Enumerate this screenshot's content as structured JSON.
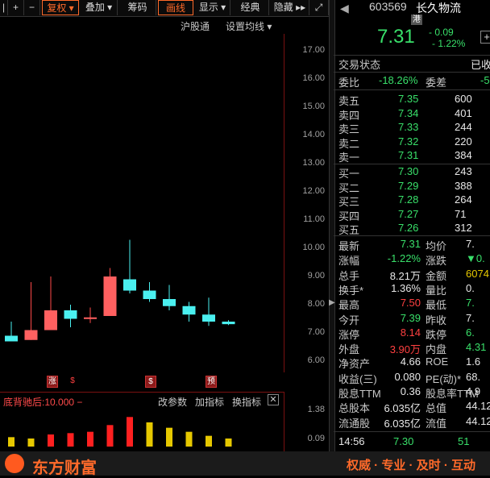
{
  "toolbar": {
    "items": [
      "|",
      "+",
      "−",
      "复权",
      "叠加",
      "筹码",
      "画线",
      "显示",
      "经典",
      "隐藏"
    ],
    "fuquan_label": "复权",
    "overlay_label": "叠加",
    "chips_label": "筹码",
    "draw_label": "画线",
    "show_label": "显示",
    "classic_label": "经典",
    "hide_label": "隐藏",
    "expand_icon": "expand-icon"
  },
  "subtoolbar": {
    "hgt_label": "沪股通",
    "ma_label": "设置均线"
  },
  "price_axis": [
    "17.00",
    "16.00",
    "15.00",
    "14.00",
    "13.00",
    "12.00",
    "11.00",
    "10.00",
    "9.00",
    "8.00",
    "7.00",
    "6.00"
  ],
  "chart_data": {
    "type": "candlestick",
    "candles": [
      {
        "open": 6.7,
        "close": 6.9,
        "high": 7.4,
        "low": 6.7,
        "color": "cyan"
      },
      {
        "open": 6.75,
        "close": 7.1,
        "high": 8.8,
        "low": 6.75,
        "color": "red"
      },
      {
        "open": 7.1,
        "close": 7.8,
        "high": 9.0,
        "low": 7.1,
        "color": "red"
      },
      {
        "open": 7.8,
        "close": 7.5,
        "high": 8.0,
        "low": 7.2,
        "color": "cyan"
      },
      {
        "open": 7.5,
        "close": 7.55,
        "high": 7.9,
        "low": 7.35,
        "color": "red"
      },
      {
        "open": 7.6,
        "close": 9.0,
        "high": 9.3,
        "low": 7.6,
        "color": "red"
      },
      {
        "open": 8.9,
        "close": 8.5,
        "high": 10.3,
        "low": 8.4,
        "color": "cyan"
      },
      {
        "open": 8.5,
        "close": 8.2,
        "high": 8.8,
        "low": 8.1,
        "color": "cyan"
      },
      {
        "open": 8.2,
        "close": 7.95,
        "high": 8.7,
        "low": 7.8,
        "color": "cyan"
      },
      {
        "open": 7.95,
        "close": 7.65,
        "high": 8.1,
        "low": 7.4,
        "color": "cyan"
      },
      {
        "open": 7.65,
        "close": 7.4,
        "high": 8.25,
        "low": 7.25,
        "color": "cyan"
      },
      {
        "open": 7.4,
        "close": 7.31,
        "high": 7.45,
        "low": 7.28,
        "color": "cyan"
      }
    ],
    "ylim": [
      5.6,
      17.6
    ]
  },
  "badges": [
    {
      "text": "涨"
    },
    {
      "text": "$"
    },
    {
      "text": "$"
    },
    {
      "text": "预"
    }
  ],
  "indicator": {
    "title": "底背驰后:10.000 −",
    "change_param": "改参数",
    "add_indicator": "加指标",
    "switch_indicator": "换指标",
    "close_icon": "close-icon",
    "axis_top": "1.38",
    "axis_bottom": "0.09",
    "vol_bars": [
      {
        "v": 0.35,
        "color": "#e6c800"
      },
      {
        "v": 0.3,
        "color": "#e6c800"
      },
      {
        "v": 0.45,
        "color": "#ff2020"
      },
      {
        "v": 0.5,
        "color": "#ff2020"
      },
      {
        "v": 0.55,
        "color": "#ff2020"
      },
      {
        "v": 0.8,
        "color": "#ff2020"
      },
      {
        "v": 1.1,
        "color": "#ff2020"
      },
      {
        "v": 0.9,
        "color": "#e6c800"
      },
      {
        "v": 0.7,
        "color": "#e6c800"
      },
      {
        "v": 0.55,
        "color": "#e6c800"
      },
      {
        "v": 0.4,
        "color": "#e6c800"
      },
      {
        "v": 0.3,
        "color": "#e6c800"
      }
    ]
  },
  "quote": {
    "code": "603569",
    "name": "长久物流",
    "hk_tag": "港",
    "last": "7.31",
    "change": "- 0.09",
    "change_pct": "- 1.22%",
    "status_label": "交易状态",
    "status_value": "已收",
    "ratio_label": "委比",
    "ratio_value": "-18.26%",
    "diff_label": "委差",
    "diff_value": "-5",
    "sells": [
      {
        "label": "卖五",
        "price": "7.35",
        "vol": "600"
      },
      {
        "label": "卖四",
        "price": "7.34",
        "vol": "401"
      },
      {
        "label": "卖三",
        "price": "7.33",
        "vol": "244"
      },
      {
        "label": "卖二",
        "price": "7.32",
        "vol": "220"
      },
      {
        "label": "卖一",
        "price": "7.31",
        "vol": "384"
      }
    ],
    "buys": [
      {
        "label": "买一",
        "price": "7.30",
        "vol": "243"
      },
      {
        "label": "买二",
        "price": "7.29",
        "vol": "388"
      },
      {
        "label": "买三",
        "price": "7.28",
        "vol": "264"
      },
      {
        "label": "买四",
        "price": "7.27",
        "vol": "71"
      },
      {
        "label": "买五",
        "price": "7.26",
        "vol": "312"
      }
    ],
    "stats": [
      {
        "l1": "最新",
        "v1": "7.31",
        "c1": "grn",
        "l2": "均价",
        "v2": "7.",
        "c2": "wht"
      },
      {
        "l1": "涨幅",
        "v1": "-1.22%",
        "c1": "grn",
        "l2": "涨跌",
        "v2": "▼0.",
        "c2": "grn"
      },
      {
        "l1": "总手",
        "v1": "8.21万",
        "c1": "wht",
        "l2": "金额",
        "v2": "6074",
        "c2": "ylw"
      },
      {
        "l1": "换手*",
        "v1": "1.36%",
        "c1": "wht",
        "l2": "量比",
        "v2": "0.",
        "c2": "wht"
      },
      {
        "l1": "最高",
        "v1": "7.50",
        "c1": "red",
        "l2": "最低",
        "v2": "7.",
        "c2": "grn"
      },
      {
        "l1": "今开",
        "v1": "7.39",
        "c1": "grn",
        "l2": "昨收",
        "v2": "7.",
        "c2": "wht"
      },
      {
        "l1": "涨停",
        "v1": "8.14",
        "c1": "red",
        "l2": "跌停",
        "v2": "6.",
        "c2": "grn"
      },
      {
        "l1": "外盘",
        "v1": "3.90万",
        "c1": "red",
        "l2": "内盘",
        "v2": "4.31",
        "c2": "grn"
      },
      {
        "l1": "净资产",
        "v1": "4.66",
        "c1": "wht",
        "l2": "ROE",
        "v2": "1.6",
        "c2": "wht"
      },
      {
        "l1": "收益(三)",
        "v1": "0.080",
        "c1": "wht",
        "l2": "PE(动)*",
        "v2": "68.",
        "c2": "wht"
      },
      {
        "l1": "股息TTM",
        "v1": "0.36",
        "c1": "wht",
        "l2": "股息率TTM",
        "v2": "4.9",
        "c2": "wht"
      },
      {
        "l1": "总股本",
        "v1": "6.035亿",
        "c1": "wht",
        "l2": "总值",
        "v2": "44.12",
        "c2": "wht"
      },
      {
        "l1": "流通股",
        "v1": "6.035亿",
        "c1": "wht",
        "l2": "流值",
        "v2": "44.12",
        "c2": "wht"
      }
    ],
    "tick_time": "14:56",
    "tick_price": "7.30",
    "tick_vol": "51"
  },
  "footer": {
    "brand": "东方财富",
    "slogan": "权威 · 专业 · 及时 · 互动"
  }
}
